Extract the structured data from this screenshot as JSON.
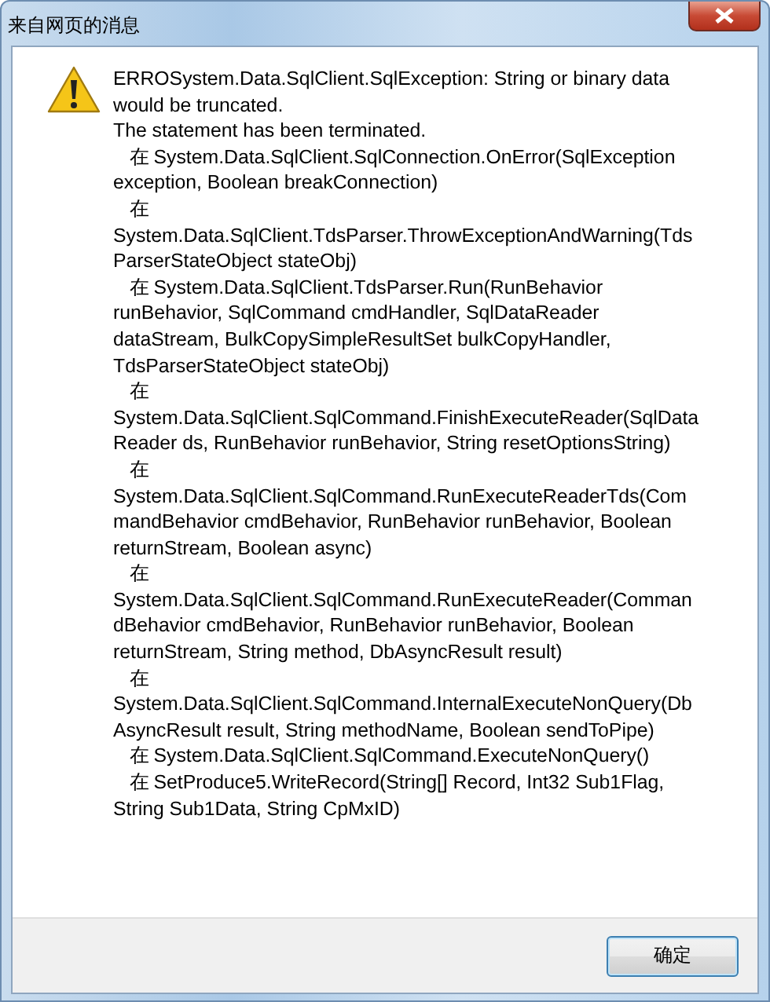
{
  "window": {
    "title": "来自网页的消息"
  },
  "message": "ERROSystem.Data.SqlClient.SqlException: String or binary data\nwould be truncated.\nThe statement has been terminated.\n   在 System.Data.SqlClient.SqlConnection.OnError(SqlException\nexception, Boolean breakConnection)\n   在\nSystem.Data.SqlClient.TdsParser.ThrowExceptionAndWarning(Tds\nParserStateObject stateObj)\n   在 System.Data.SqlClient.TdsParser.Run(RunBehavior\nrunBehavior, SqlCommand cmdHandler, SqlDataReader\ndataStream, BulkCopySimpleResultSet bulkCopyHandler,\nTdsParserStateObject stateObj)\n   在\nSystem.Data.SqlClient.SqlCommand.FinishExecuteReader(SqlData\nReader ds, RunBehavior runBehavior, String resetOptionsString)\n   在\nSystem.Data.SqlClient.SqlCommand.RunExecuteReaderTds(Com\nmandBehavior cmdBehavior, RunBehavior runBehavior, Boolean\nreturnStream, Boolean async)\n   在\nSystem.Data.SqlClient.SqlCommand.RunExecuteReader(Comman\ndBehavior cmdBehavior, RunBehavior runBehavior, Boolean\nreturnStream, String method, DbAsyncResult result)\n   在\nSystem.Data.SqlClient.SqlCommand.InternalExecuteNonQuery(Db\nAsyncResult result, String methodName, Boolean sendToPipe)\n   在 System.Data.SqlClient.SqlCommand.ExecuteNonQuery()\n   在 SetProduce5.WriteRecord(String[] Record, Int32 Sub1Flag,\nString Sub1Data, String CpMxID)",
  "buttons": [
    "确定"
  ]
}
